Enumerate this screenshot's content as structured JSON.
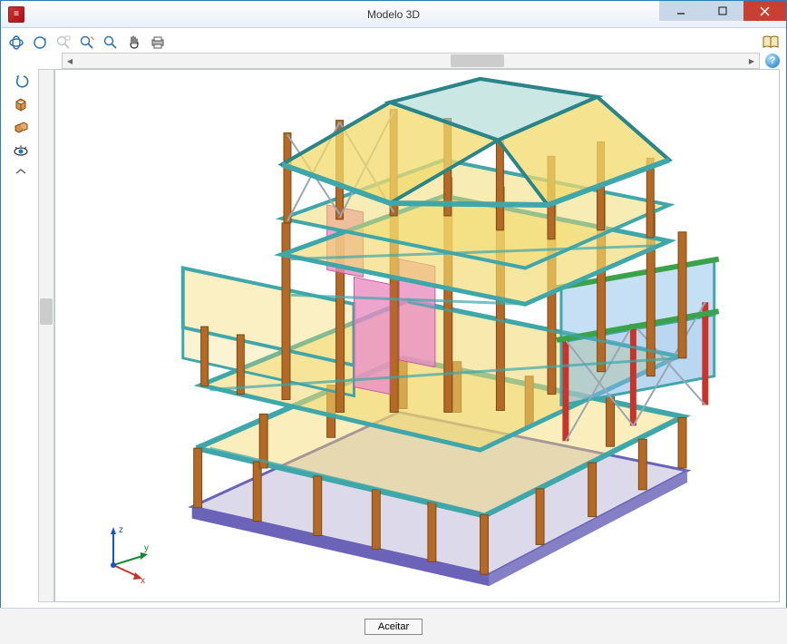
{
  "window": {
    "title": "Modelo 3D",
    "app_icon_glyph": "≡"
  },
  "toolbar_top": [
    {
      "name": "orbit-icon"
    },
    {
      "name": "rotate-icon"
    },
    {
      "name": "zoom-window-icon"
    },
    {
      "name": "zoom-extents-icon"
    },
    {
      "name": "zoom-icon"
    },
    {
      "name": "pan-icon"
    },
    {
      "name": "print-icon"
    }
  ],
  "toolbar_side": [
    {
      "name": "undo-icon"
    },
    {
      "name": "box-icon"
    },
    {
      "name": "boxes-icon"
    },
    {
      "name": "eye-icon"
    },
    {
      "name": "chevron-up-icon"
    }
  ],
  "help_icon": "?",
  "manual_icon_name": "book-icon",
  "scrollbar": {
    "h_thumb_left_pct": 56,
    "h_thumb_width_pct": 8,
    "v_thumb_top_pct": 43,
    "v_thumb_height_pct": 5
  },
  "axis": {
    "x": "x",
    "y": "y",
    "z": "z"
  },
  "buttons": {
    "accept": "Aceitar"
  },
  "colors": {
    "beam_teal": "#3fa7aa",
    "column_brown": "#b46a26",
    "slab_yellow": "#f2d96b",
    "slab_blue": "#7fb7e6",
    "wall_pink": "#e98fc2",
    "base_purple": "#6a63b8",
    "brace_red": "#c8332a",
    "brace_grey": "#9aa6b2",
    "edge_green": "#3aa24a"
  }
}
